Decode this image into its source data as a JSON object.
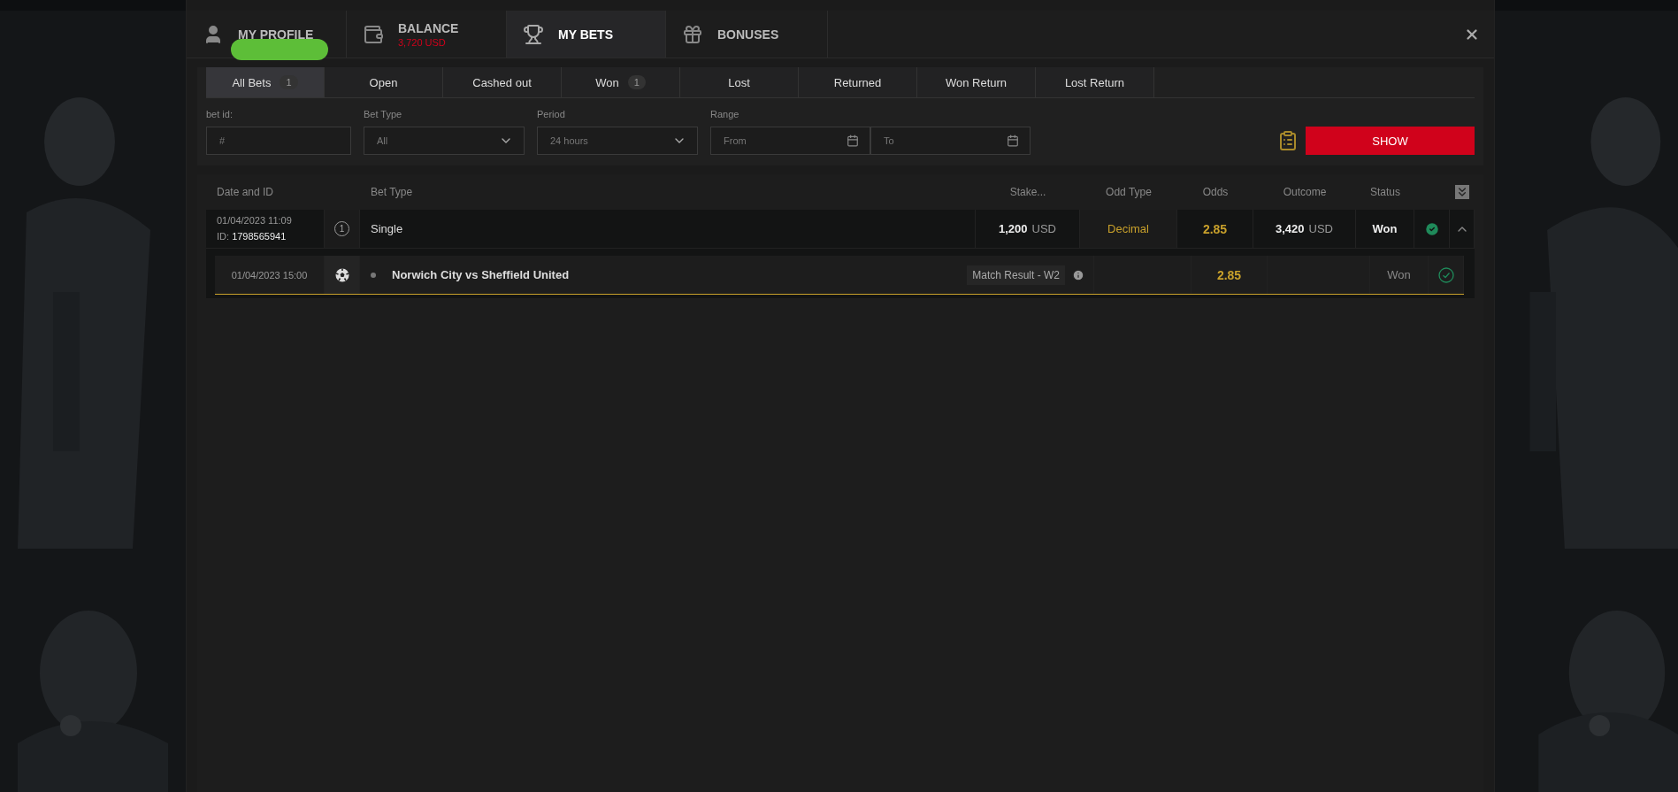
{
  "top_tabs": [
    {
      "kind": "profile",
      "label": "MY PROFILE",
      "redacted": true,
      "selected": false
    },
    {
      "kind": "balance",
      "label": "BALANCE",
      "sub": "3,720 USD",
      "selected": false
    },
    {
      "kind": "bets",
      "label": "MY BETS",
      "selected": true
    },
    {
      "kind": "bonuses",
      "label": "BONUSES",
      "selected": false
    }
  ],
  "filter_tabs": [
    {
      "label": "All Bets",
      "count": "1",
      "selected": true
    },
    {
      "label": "Open",
      "selected": false
    },
    {
      "label": "Cashed out",
      "selected": false
    },
    {
      "label": "Won",
      "count": "1",
      "selected": false
    },
    {
      "label": "Lost",
      "selected": false
    },
    {
      "label": "Returned",
      "selected": false
    },
    {
      "label": "Won Return",
      "selected": false
    },
    {
      "label": "Lost Return",
      "selected": false
    }
  ],
  "filters": [
    {
      "kind": "text",
      "label": "bet id:",
      "placeholder": "#"
    },
    {
      "kind": "select",
      "label": "Bet Type",
      "value": "All"
    },
    {
      "kind": "select",
      "label": "Period",
      "value": "24 hours"
    },
    {
      "kind": "range",
      "label": "Range",
      "from_placeholder": "From",
      "to_placeholder": "To"
    }
  ],
  "show_button": "SHOW",
  "table": {
    "columns": [
      "Date and ID",
      "Bet Type",
      "Stake...",
      "Odd Type",
      "Odds",
      "Outcome",
      "Status"
    ],
    "bets": [
      {
        "date": "01/04/2023 11:09",
        "id_label": "ID:",
        "id": "1798565941",
        "count": "1",
        "bet_type": "Single",
        "stake": "1,200",
        "stake_currency": "USD",
        "odd_type": "Decimal",
        "odds": "2.85",
        "outcome": "3,420",
        "outcome_currency": "USD",
        "status": "Won",
        "expanded": true,
        "events": [
          {
            "date": "01/04/2023 15:00",
            "match": "Norwich City vs Sheffield United",
            "market": "Match Result - W2",
            "odds": "2.85",
            "status": "Won"
          }
        ]
      }
    ]
  }
}
